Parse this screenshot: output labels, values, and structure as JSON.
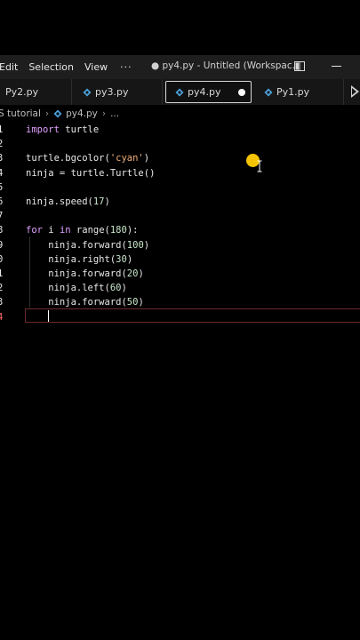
{
  "titlebar": {
    "menu": [
      "Edit",
      "Selection",
      "View"
    ],
    "more": "···",
    "window_title": "● py4.py - Untitled (Workspac..."
  },
  "tabs": [
    {
      "label": "Py2.py",
      "has_icon": false,
      "active": false
    },
    {
      "label": "py3.py",
      "has_icon": true,
      "active": false
    },
    {
      "label": "py4.py",
      "has_icon": true,
      "active": true,
      "modified": true
    },
    {
      "label": "Py1.py",
      "has_icon": true,
      "active": false
    }
  ],
  "breadcrumb": {
    "folder": "S tutorial",
    "file": "py4.py",
    "tail": "..."
  },
  "editor": {
    "line_numbers": [
      "1",
      "2",
      "3",
      "4",
      "5",
      "6",
      "7",
      "8",
      "9",
      "0",
      "1",
      "2",
      "3",
      "4"
    ],
    "lines": [
      "import turtle",
      "",
      "turtle.bgcolor('cyan')",
      "ninja = turtle.Turtle()",
      "",
      "ninja.speed(17)",
      "",
      "for i in range(180):",
      "    ninja.forward(100)",
      "    ninja.right(30)",
      "    ninja.forward(20)",
      "    ninja.left(60)",
      "    ninja.forward(50)",
      ""
    ],
    "current_line_index": 13
  },
  "colors": {
    "background": "#000000",
    "titlebar": "#1e1e1e",
    "tabbar": "#161616",
    "keyword": "#e0a0ff",
    "string": "#f2b07a",
    "current_line_number": "#ff6b6b",
    "python_icon_blue": "#4aa3df",
    "pointer_highlight": "#f5c400"
  },
  "icons": {
    "layout": "layout-icon",
    "minimize": "minimize-icon",
    "python_file": "python-file-icon",
    "unsaved": "unsaved-dot-icon",
    "run": "run-icon",
    "pointer": "mouse-pointer-highlight-icon"
  }
}
